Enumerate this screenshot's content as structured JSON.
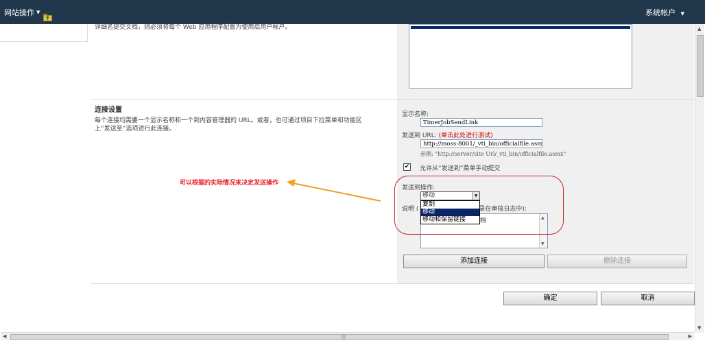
{
  "topbar": {
    "site_actions": "网站操作",
    "account": "系统帐户"
  },
  "top_section": {
    "description": "详细名提交文档，则必须将每个 Web 应用程序配置为使用启用户帐户。"
  },
  "connection_settings": {
    "title": "连接设置",
    "description": "每个连接均需要一个显示名称和一个到内容管理器的 URL。或者，也可通过项目下拉菜单和功能区上“发送至”选项进行此连接。",
    "display_name_label": "显示名称:",
    "display_name_value": "TimerJobSendLink",
    "url_label_prefix": "发送到 URL:",
    "url_test_link": "(单击此处进行测试)",
    "url_value": "http://moss:8001/_vti_bin/officialfile.asmx",
    "url_example": "示例: \"http://server/site Url/_vti_bin/officialfile.asmx\"",
    "allow_manual_label": "允许从“发送到”菜单手动提交",
    "allow_manual_checked": true,
    "send_action_label": "发送到操作:",
    "send_action_selected": "移动",
    "send_action_options": [
      "复制",
      "移动",
      "移动和保留链接"
    ],
    "send_action_highlighted": "移动",
    "comment_label_prefix": "说明 (",
    "comment_label_suffix": "录在审核日志中):",
    "comment_text": "档",
    "add_connection_button": "添加连接",
    "remove_connection_button": "删除连接"
  },
  "annotation": {
    "text": "可以根据的实际情况来决定发送操作",
    "color": "#e8262d",
    "arrow_color": "#f0a020",
    "circle_color": "#c0282d"
  },
  "footer": {
    "ok_button": "确定",
    "cancel_button": "取消"
  },
  "colors": {
    "topbar": "#21374c",
    "panel": "#f0f0f0",
    "selection": "#0a246a"
  }
}
